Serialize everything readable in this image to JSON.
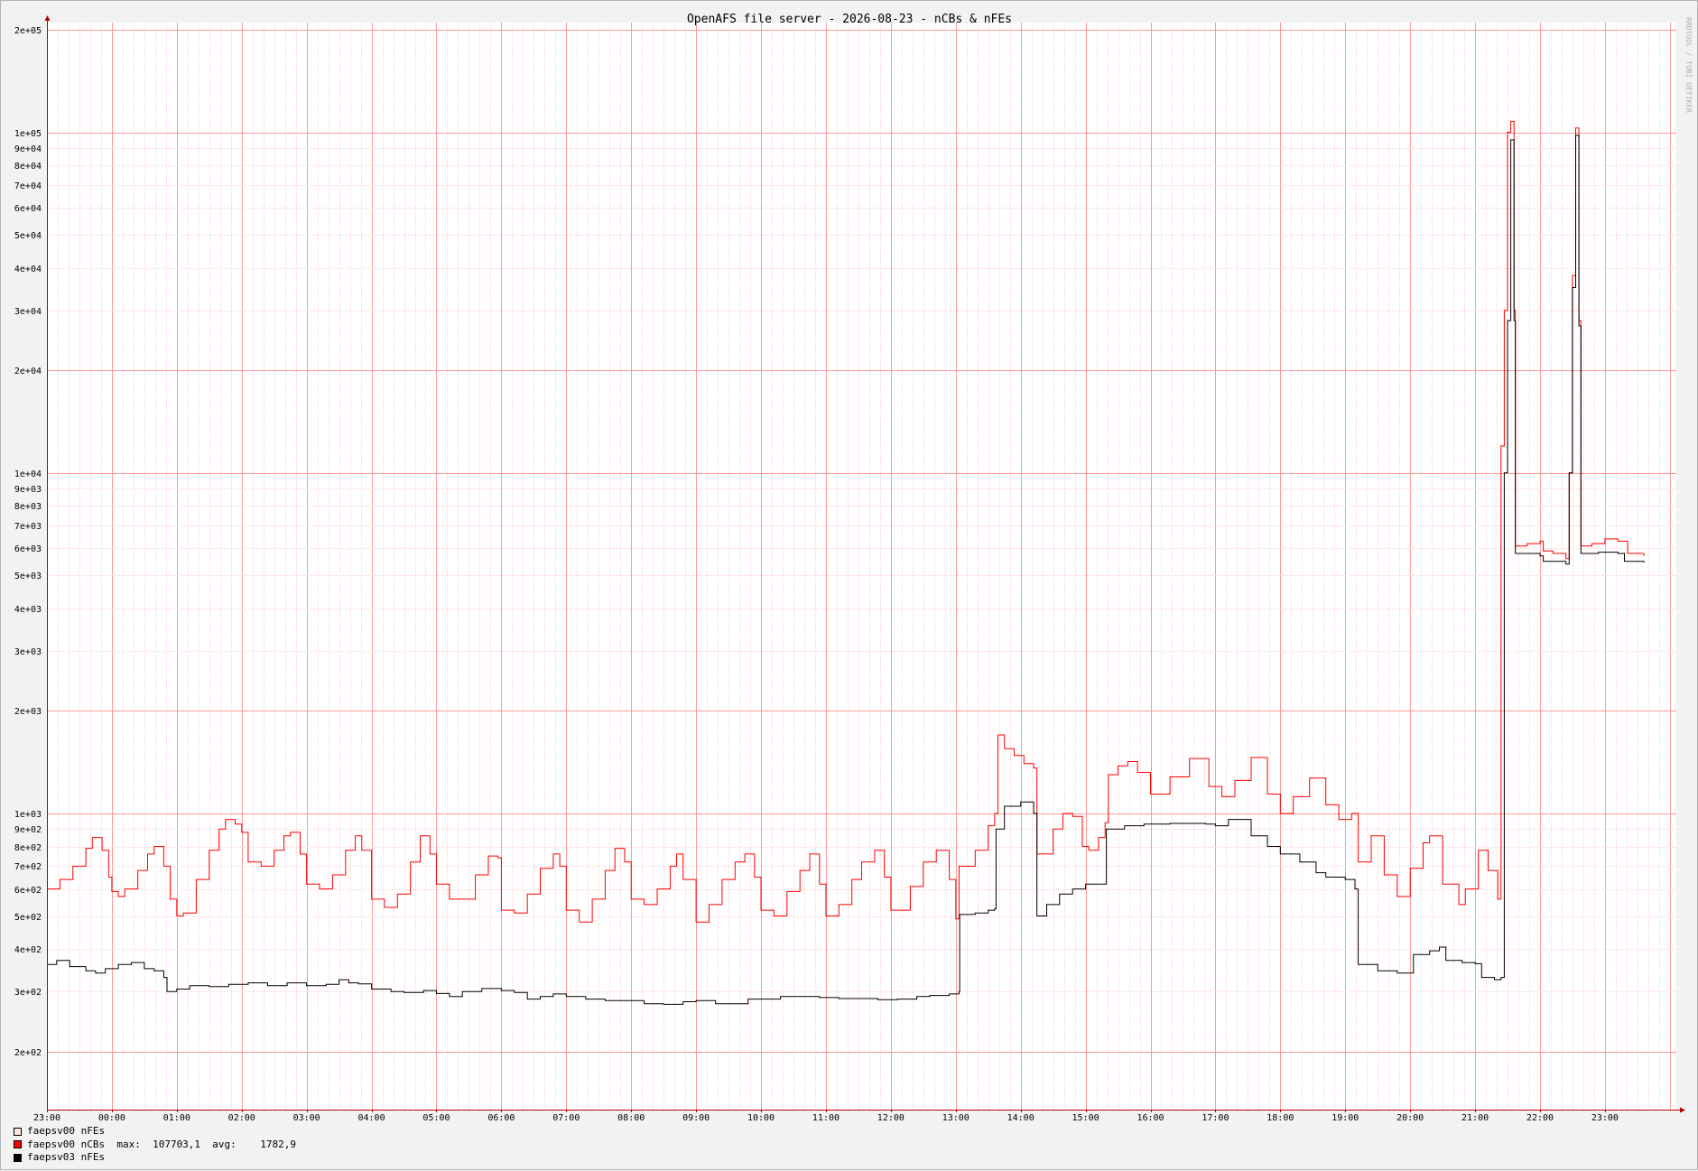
{
  "window": {
    "watermark": "RRDTOOL / TOBI OETIKER"
  },
  "colors": {
    "ncbs": "#ff0000",
    "nfes03": "#000000",
    "nfes00": "#ffc8c8",
    "grid_minor": "#ffd0d0",
    "grid_major": "#ff9a9a",
    "axis": "#b00000",
    "canvas": "#ffffff",
    "background": "#f2f2f2"
  },
  "legend": [
    {
      "label": "faepsv00 nFEs",
      "swatch": "#ffe4e4",
      "stats": ""
    },
    {
      "label": "faepsv00 nCBs",
      "swatch": "#ff0000",
      "stats": "  max:  107703,1  avg:    1782,9"
    },
    {
      "label": "faepsv03 nFEs",
      "swatch": "#000000",
      "stats": ""
    }
  ],
  "chart_data": {
    "type": "line",
    "title": "OpenAFS file server - 2026-08-23 - nCBs & nFEs",
    "xlabel": "",
    "ylabel": "",
    "x_unit": "hours since 23:00 of previous day",
    "xlim": [
      0,
      25.1
    ],
    "y_scale": "log",
    "ylim": [
      135,
      210000
    ],
    "grid": true,
    "x_ticks": [
      "23:00",
      "00:00",
      "01:00",
      "02:00",
      "03:00",
      "04:00",
      "05:00",
      "06:00",
      "07:00",
      "08:00",
      "09:00",
      "10:00",
      "11:00",
      "12:00",
      "13:00",
      "14:00",
      "15:00",
      "16:00",
      "17:00",
      "18:00",
      "19:00",
      "20:00",
      "21:00",
      "22:00",
      "23:00"
    ],
    "y_ticks": [
      {
        "v": 200,
        "label": "2e+02"
      },
      {
        "v": 300,
        "label": "3e+02"
      },
      {
        "v": 400,
        "label": "4e+02"
      },
      {
        "v": 500,
        "label": "5e+02"
      },
      {
        "v": 600,
        "label": "6e+02"
      },
      {
        "v": 700,
        "label": "7e+02"
      },
      {
        "v": 800,
        "label": "8e+02"
      },
      {
        "v": 900,
        "label": "9e+02"
      },
      {
        "v": 1000,
        "label": "1e+03"
      },
      {
        "v": 2000,
        "label": "2e+03"
      },
      {
        "v": 3000,
        "label": "3e+03"
      },
      {
        "v": 4000,
        "label": "4e+03"
      },
      {
        "v": 5000,
        "label": "5e+03"
      },
      {
        "v": 6000,
        "label": "6e+03"
      },
      {
        "v": 7000,
        "label": "7e+03"
      },
      {
        "v": 8000,
        "label": "8e+03"
      },
      {
        "v": 9000,
        "label": "9e+03"
      },
      {
        "v": 10000,
        "label": "1e+04"
      },
      {
        "v": 20000,
        "label": "2e+04"
      },
      {
        "v": 30000,
        "label": "3e+04"
      },
      {
        "v": 40000,
        "label": "4e+04"
      },
      {
        "v": 50000,
        "label": "5e+04"
      },
      {
        "v": 60000,
        "label": "6e+04"
      },
      {
        "v": 70000,
        "label": "7e+04"
      },
      {
        "v": 80000,
        "label": "8e+04"
      },
      {
        "v": 90000,
        "label": "9e+04"
      },
      {
        "v": 100000,
        "label": "1e+05"
      },
      {
        "v": 200000,
        "label": "2e+05"
      }
    ],
    "series": [
      {
        "name": "faepsv00 nCBs",
        "color": "#ff0000",
        "points": [
          [
            0,
            600
          ],
          [
            0.2,
            640
          ],
          [
            0.4,
            700
          ],
          [
            0.6,
            790
          ],
          [
            0.7,
            850
          ],
          [
            0.85,
            780
          ],
          [
            0.95,
            650
          ],
          [
            1.0,
            590
          ],
          [
            1.1,
            570
          ],
          [
            1.2,
            600
          ],
          [
            1.4,
            680
          ],
          [
            1.55,
            760
          ],
          [
            1.65,
            800
          ],
          [
            1.8,
            700
          ],
          [
            1.9,
            560
          ],
          [
            2.0,
            500
          ],
          [
            2.1,
            510
          ],
          [
            2.3,
            640
          ],
          [
            2.5,
            780
          ],
          [
            2.65,
            900
          ],
          [
            2.75,
            960
          ],
          [
            2.9,
            930
          ],
          [
            3.0,
            880
          ],
          [
            3.1,
            720
          ],
          [
            3.3,
            700
          ],
          [
            3.5,
            780
          ],
          [
            3.65,
            860
          ],
          [
            3.75,
            880
          ],
          [
            3.9,
            760
          ],
          [
            4.0,
            620
          ],
          [
            4.2,
            600
          ],
          [
            4.4,
            660
          ],
          [
            4.6,
            780
          ],
          [
            4.75,
            860
          ],
          [
            4.85,
            780
          ],
          [
            5.0,
            560
          ],
          [
            5.2,
            530
          ],
          [
            5.4,
            580
          ],
          [
            5.6,
            720
          ],
          [
            5.75,
            860
          ],
          [
            5.9,
            760
          ],
          [
            6.0,
            620
          ],
          [
            6.2,
            560
          ],
          [
            6.4,
            560
          ],
          [
            6.6,
            660
          ],
          [
            6.8,
            750
          ],
          [
            6.95,
            740
          ],
          [
            7.0,
            520
          ],
          [
            7.2,
            510
          ],
          [
            7.4,
            580
          ],
          [
            7.6,
            690
          ],
          [
            7.8,
            760
          ],
          [
            7.9,
            700
          ],
          [
            8.0,
            520
          ],
          [
            8.2,
            480
          ],
          [
            8.4,
            560
          ],
          [
            8.6,
            680
          ],
          [
            8.75,
            790
          ],
          [
            8.9,
            720
          ],
          [
            9.0,
            560
          ],
          [
            9.2,
            540
          ],
          [
            9.4,
            600
          ],
          [
            9.6,
            700
          ],
          [
            9.7,
            760
          ],
          [
            9.8,
            640
          ],
          [
            10.0,
            480
          ],
          [
            10.2,
            540
          ],
          [
            10.4,
            640
          ],
          [
            10.6,
            720
          ],
          [
            10.75,
            760
          ],
          [
            10.9,
            650
          ],
          [
            11.0,
            520
          ],
          [
            11.2,
            500
          ],
          [
            11.4,
            590
          ],
          [
            11.6,
            680
          ],
          [
            11.75,
            760
          ],
          [
            11.9,
            620
          ],
          [
            12.0,
            500
          ],
          [
            12.2,
            540
          ],
          [
            12.4,
            640
          ],
          [
            12.55,
            720
          ],
          [
            12.75,
            780
          ],
          [
            12.9,
            650
          ],
          [
            13.0,
            520
          ],
          [
            13.1,
            520
          ],
          [
            13.3,
            610
          ],
          [
            13.5,
            720
          ],
          [
            13.7,
            780
          ],
          [
            13.9,
            640
          ],
          [
            14.0,
            490
          ],
          [
            14.05,
            700
          ],
          [
            14.3,
            780
          ],
          [
            14.5,
            920
          ],
          [
            14.6,
            1000
          ],
          [
            14.65,
            1700
          ],
          [
            14.75,
            1550
          ],
          [
            14.9,
            1480
          ],
          [
            15.05,
            1400
          ],
          [
            15.2,
            1360
          ],
          [
            15.25,
            760
          ],
          [
            15.5,
            900
          ],
          [
            15.65,
            1000
          ],
          [
            15.8,
            980
          ],
          [
            15.95,
            800
          ],
          [
            16.05,
            780
          ],
          [
            16.2,
            850
          ],
          [
            16.3,
            940
          ],
          [
            16.35,
            1300
          ],
          [
            16.5,
            1380
          ],
          [
            16.65,
            1420
          ],
          [
            16.8,
            1320
          ],
          [
            17.0,
            1140
          ],
          [
            17.3,
            1280
          ],
          [
            17.6,
            1450
          ],
          [
            17.9,
            1200
          ],
          [
            18.1,
            1120
          ],
          [
            18.3,
            1250
          ],
          [
            18.55,
            1460
          ],
          [
            18.8,
            1140
          ],
          [
            19.0,
            1000
          ],
          [
            19.2,
            1120
          ],
          [
            19.45,
            1270
          ],
          [
            19.7,
            1060
          ],
          [
            19.9,
            960
          ],
          [
            20.1,
            1000
          ],
          [
            20.2,
            720
          ],
          [
            20.4,
            860
          ],
          [
            20.6,
            660
          ],
          [
            20.8,
            570
          ],
          [
            21.0,
            690
          ],
          [
            21.2,
            820
          ],
          [
            21.3,
            860
          ],
          [
            21.5,
            620
          ],
          [
            21.75,
            540
          ],
          [
            21.85,
            600
          ],
          [
            22.05,
            780
          ],
          [
            22.2,
            680
          ],
          [
            22.35,
            560
          ],
          [
            22.4,
            12000
          ],
          [
            22.45,
            30000
          ],
          [
            22.5,
            100000
          ],
          [
            22.55,
            107703
          ],
          [
            22.6,
            30000
          ],
          [
            22.62,
            6100
          ],
          [
            22.8,
            6200
          ],
          [
            23.0,
            6300
          ],
          [
            23.05,
            5900
          ],
          [
            23.2,
            5800
          ],
          [
            23.4,
            5600
          ],
          [
            23.45,
            10000
          ],
          [
            23.5,
            38000
          ],
          [
            23.55,
            103000
          ],
          [
            23.6,
            28000
          ],
          [
            23.63,
            6100
          ],
          [
            23.8,
            6200
          ],
          [
            24.0,
            6400
          ],
          [
            24.2,
            6300
          ],
          [
            24.35,
            5800
          ],
          [
            24.5,
            5800
          ],
          [
            24.6,
            5700
          ]
        ]
      },
      {
        "name": "faepsv03 nFEs",
        "color": "#000000",
        "points": [
          [
            0,
            360
          ],
          [
            0.15,
            370
          ],
          [
            0.35,
            355
          ],
          [
            0.6,
            345
          ],
          [
            0.75,
            340
          ],
          [
            0.9,
            350
          ],
          [
            1.1,
            360
          ],
          [
            1.3,
            365
          ],
          [
            1.5,
            350
          ],
          [
            1.65,
            345
          ],
          [
            1.8,
            330
          ],
          [
            1.85,
            300
          ],
          [
            2.0,
            305
          ],
          [
            2.2,
            312
          ],
          [
            2.5,
            310
          ],
          [
            2.8,
            315
          ],
          [
            3.1,
            318
          ],
          [
            3.4,
            312
          ],
          [
            3.7,
            318
          ],
          [
            4.0,
            312
          ],
          [
            4.3,
            315
          ],
          [
            4.5,
            325
          ],
          [
            4.65,
            318
          ],
          [
            4.8,
            316
          ],
          [
            5.0,
            305
          ],
          [
            5.3,
            300
          ],
          [
            5.5,
            298
          ],
          [
            5.8,
            302
          ],
          [
            6.0,
            296
          ],
          [
            6.2,
            290
          ],
          [
            6.4,
            300
          ],
          [
            6.7,
            306
          ],
          [
            7.0,
            302
          ],
          [
            7.2,
            298
          ],
          [
            7.4,
            285
          ],
          [
            7.6,
            290
          ],
          [
            7.8,
            295
          ],
          [
            8.0,
            290
          ],
          [
            8.3,
            285
          ],
          [
            8.6,
            282
          ],
          [
            8.9,
            282
          ],
          [
            9.2,
            276
          ],
          [
            9.5,
            275
          ],
          [
            9.8,
            280
          ],
          [
            10.0,
            282
          ],
          [
            10.3,
            276
          ],
          [
            10.6,
            276
          ],
          [
            10.8,
            285
          ],
          [
            11.0,
            285
          ],
          [
            11.3,
            290
          ],
          [
            11.6,
            290
          ],
          [
            11.9,
            288
          ],
          [
            12.2,
            286
          ],
          [
            12.5,
            286
          ],
          [
            12.8,
            284
          ],
          [
            13.1,
            285
          ],
          [
            13.4,
            290
          ],
          [
            13.6,
            292
          ],
          [
            13.9,
            295
          ],
          [
            14.05,
            300
          ],
          [
            14.06,
            505
          ],
          [
            14.3,
            510
          ],
          [
            14.5,
            520
          ],
          [
            14.6,
            525
          ],
          [
            14.62,
            900
          ],
          [
            14.75,
            1050
          ],
          [
            15.0,
            1080
          ],
          [
            15.2,
            1000
          ],
          [
            15.25,
            500
          ],
          [
            15.4,
            540
          ],
          [
            15.6,
            580
          ],
          [
            15.8,
            600
          ],
          [
            16.0,
            620
          ],
          [
            16.3,
            620
          ],
          [
            16.32,
            900
          ],
          [
            16.6,
            920
          ],
          [
            16.9,
            930
          ],
          [
            17.3,
            935
          ],
          [
            17.7,
            935
          ],
          [
            17.85,
            930
          ],
          [
            18.0,
            920
          ],
          [
            18.2,
            960
          ],
          [
            18.5,
            960
          ],
          [
            18.55,
            860
          ],
          [
            18.8,
            800
          ],
          [
            19.0,
            760
          ],
          [
            19.3,
            720
          ],
          [
            19.55,
            670
          ],
          [
            19.7,
            650
          ],
          [
            20.0,
            640
          ],
          [
            20.15,
            600
          ],
          [
            20.2,
            360
          ],
          [
            20.5,
            345
          ],
          [
            20.8,
            340
          ],
          [
            21.0,
            340
          ],
          [
            21.05,
            385
          ],
          [
            21.3,
            395
          ],
          [
            21.45,
            405
          ],
          [
            21.55,
            370
          ],
          [
            21.8,
            365
          ],
          [
            22.0,
            362
          ],
          [
            22.1,
            330
          ],
          [
            22.3,
            325
          ],
          [
            22.4,
            330
          ],
          [
            22.45,
            10000
          ],
          [
            22.5,
            28000
          ],
          [
            22.55,
            95000
          ],
          [
            22.6,
            28000
          ],
          [
            22.62,
            5800
          ],
          [
            22.9,
            5800
          ],
          [
            23.0,
            5700
          ],
          [
            23.05,
            5500
          ],
          [
            23.4,
            5400
          ],
          [
            23.45,
            10000
          ],
          [
            23.5,
            35000
          ],
          [
            23.55,
            98000
          ],
          [
            23.6,
            27000
          ],
          [
            23.63,
            5800
          ],
          [
            23.9,
            5850
          ],
          [
            24.2,
            5800
          ],
          [
            24.3,
            5500
          ],
          [
            24.6,
            5450
          ]
        ]
      }
    ]
  }
}
